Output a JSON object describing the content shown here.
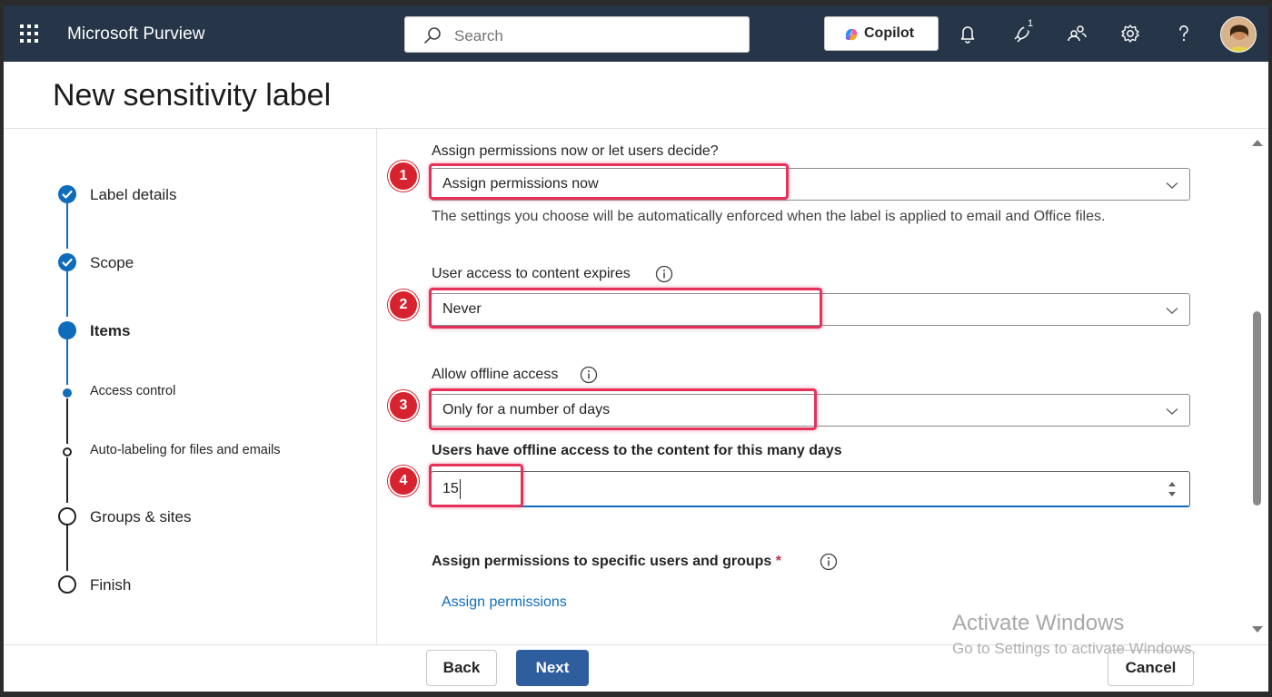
{
  "topbar": {
    "app_title": "Microsoft Purview",
    "search_placeholder": "Search",
    "copilot_label": "Copilot",
    "notification_badge": "1",
    "icons": [
      "waffle-icon",
      "search-icon",
      "copilot-icon",
      "bell-icon",
      "rocket-icon",
      "people-icon",
      "gear-icon",
      "help-icon",
      "avatar"
    ]
  },
  "page": {
    "title": "New sensitivity label"
  },
  "stepper": {
    "steps": [
      {
        "label": "Label details",
        "state": "completed"
      },
      {
        "label": "Scope",
        "state": "completed"
      },
      {
        "label": "Items",
        "state": "current"
      },
      {
        "label": "Access control",
        "state": "current-sub"
      },
      {
        "label": "Auto-labeling for files and emails",
        "state": "pending-sub"
      },
      {
        "label": "Groups & sites",
        "state": "pending"
      },
      {
        "label": "Finish",
        "state": "pending"
      }
    ]
  },
  "form": {
    "assign_question": "Assign permissions now or let users decide?",
    "assign_value": "Assign permissions now",
    "assign_helper": "The settings you choose will be automatically enforced when the label is applied to email and Office files.",
    "expiry_label": "User access to content expires",
    "expiry_value": "Never",
    "offline_label": "Allow offline access",
    "offline_value": "Only for a number of days",
    "days_label": "Users have offline access to the content for this many days",
    "days_value": "15",
    "specific_label": "Assign permissions to specific users and groups",
    "required_mark": "*",
    "assign_link": "Assign permissions"
  },
  "markers": [
    "1",
    "2",
    "3",
    "4"
  ],
  "footer": {
    "back": "Back",
    "next": "Next",
    "cancel": "Cancel"
  },
  "watermark": {
    "line1": "Activate Windows",
    "line2": "Go to Settings to activate Windows."
  },
  "colors": {
    "topbar": "#263648",
    "accent": "#0f6cbd",
    "next_button": "#2f5e9e",
    "highlight": "#e6325b",
    "marker": "#d6232f"
  }
}
